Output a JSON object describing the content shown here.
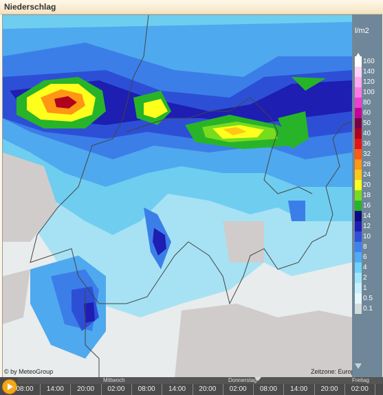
{
  "window": {
    "title": "Niederschlag"
  },
  "map": {
    "copyright": "© by MeteoGroup",
    "timezone": "Zeitzone: Europe/Zurich"
  },
  "legend": {
    "unit": "l/m2",
    "levels": [
      {
        "label": "160",
        "color": "#ffffff"
      },
      {
        "label": "140",
        "color": "#ffd2f5"
      },
      {
        "label": "120",
        "color": "#ffa8ee"
      },
      {
        "label": "100",
        "color": "#ff78e6"
      },
      {
        "label": "80",
        "color": "#f03cd2"
      },
      {
        "label": "60",
        "color": "#c8009b"
      },
      {
        "label": "50",
        "color": "#7a0046"
      },
      {
        "label": "40",
        "color": "#b0001e"
      },
      {
        "label": "36",
        "color": "#e81414"
      },
      {
        "label": "32",
        "color": "#ff5a14"
      },
      {
        "label": "28",
        "color": "#ff9614"
      },
      {
        "label": "24",
        "color": "#ffc814"
      },
      {
        "label": "20",
        "color": "#ffff1e"
      },
      {
        "label": "18",
        "color": "#78dc1e"
      },
      {
        "label": "16",
        "color": "#28b428"
      },
      {
        "label": "14",
        "color": "#0a0a82"
      },
      {
        "label": "12",
        "color": "#1e1eb4"
      },
      {
        "label": "10",
        "color": "#2d50dc"
      },
      {
        "label": "8",
        "color": "#3c82f0"
      },
      {
        "label": "6",
        "color": "#50aaf5"
      },
      {
        "label": "4",
        "color": "#6ed2fa"
      },
      {
        "label": "2",
        "color": "#a0e6fa"
      },
      {
        "label": "1",
        "color": "#c8f0fa"
      },
      {
        "label": "0.5",
        "color": "#e6f8fc"
      },
      {
        "label": "0.1",
        "color": "#d2dcdc"
      }
    ]
  },
  "timeline": {
    "days": [
      "Mittwoch",
      "Donnerstag",
      "Freitag"
    ],
    "hours": [
      "08:00",
      "14:00",
      "20:00",
      "02:00",
      "08:00",
      "14:00",
      "20:00",
      "02:00",
      "08:00",
      "14:00",
      "20:00",
      "02:00"
    ]
  }
}
